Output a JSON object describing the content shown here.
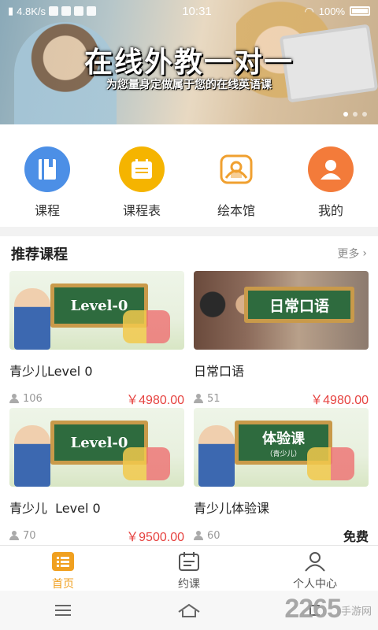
{
  "status_bar": {
    "network_speed": "4.8K/s",
    "time": "10:31",
    "battery": "100%"
  },
  "banner": {
    "title": "在线外教一对一",
    "subtitle": "为您量身定做属于您的在线英语课"
  },
  "categories": [
    {
      "label": "课程",
      "icon": "book-icon",
      "color": "#4c8fe6"
    },
    {
      "label": "课程表",
      "icon": "schedule-icon",
      "color": "#f5b400"
    },
    {
      "label": "绘本馆",
      "icon": "picture-book-icon",
      "color": "#f0a030"
    },
    {
      "label": "我的",
      "icon": "user-icon",
      "color": "#f37b3a"
    }
  ],
  "recommend": {
    "title": "推荐课程",
    "more": "更多",
    "courses": [
      {
        "name": "青少儿Level 0",
        "board": "Level-0",
        "students": "106",
        "price": "￥4980.00"
      },
      {
        "name": "日常口语",
        "board": "日常口语",
        "students": "51",
        "price": "￥4980.00"
      },
      {
        "name": "青少儿  Level 0",
        "board": "Level-0",
        "students": "70",
        "price": "￥9500.00"
      },
      {
        "name": "青少儿体验课",
        "board": "体验课",
        "board_sub": "（青少儿）",
        "students": "60",
        "price": "免费"
      }
    ]
  },
  "tabbar": [
    {
      "label": "首页",
      "icon": "home-list-icon",
      "active": true
    },
    {
      "label": "约课",
      "icon": "calendar-icon",
      "active": false
    },
    {
      "label": "个人中心",
      "icon": "profile-icon",
      "active": false
    }
  ],
  "watermark": {
    "brand": "2265",
    "suffix": "手游网"
  },
  "colors": {
    "accent": "#f0a020",
    "price": "#e64340"
  }
}
